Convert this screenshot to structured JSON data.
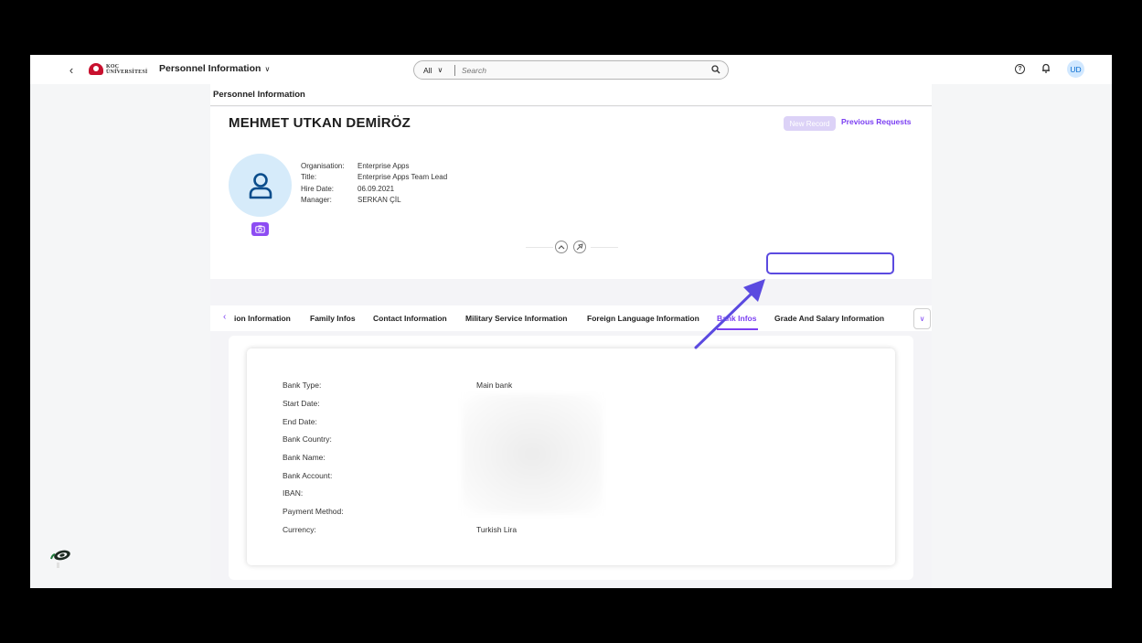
{
  "shell": {
    "logo_line1": "KOÇ",
    "logo_line2": "ÜNİVERSİTESİ",
    "app_title": "Personnel Information",
    "search_scope": "All",
    "search_placeholder": "Search",
    "avatar_initials": "UD"
  },
  "page": {
    "header_title": "Personnel Information",
    "employee_name": "MEHMET UTKAN DEMİRÖZ",
    "new_record_label": "New Record",
    "previous_requests_label": "Previous Requests",
    "attributes": [
      {
        "label": "Organisation:",
        "value": "Enterprise Apps"
      },
      {
        "label": "Title:",
        "value": "Enterprise Apps Team Lead"
      },
      {
        "label": "Hire Date:",
        "value": "06.09.2021"
      },
      {
        "label": "Manager:",
        "value": "SERKAN ÇİL"
      }
    ]
  },
  "tabs": [
    {
      "label": "ion Information",
      "selected": false
    },
    {
      "label": "Family Infos",
      "selected": false
    },
    {
      "label": "Contact Information",
      "selected": false
    },
    {
      "label": "Military Service Information",
      "selected": false
    },
    {
      "label": "Foreign Language Information",
      "selected": false
    },
    {
      "label": "Bank Infos",
      "selected": true
    },
    {
      "label": "Grade And Salary Information",
      "selected": false,
      "highlighted": true
    }
  ],
  "bank_form": {
    "fields": [
      {
        "label": "Bank Type:",
        "value": "Main bank"
      },
      {
        "label": "Start Date:",
        "value": ""
      },
      {
        "label": "End Date:",
        "value": ""
      },
      {
        "label": "Bank Country:",
        "value": ""
      },
      {
        "label": "Bank Name:",
        "value": ""
      },
      {
        "label": "Bank Account:",
        "value": ""
      },
      {
        "label": "IBAN:",
        "value": ""
      },
      {
        "label": "Payment Method:",
        "value": ""
      },
      {
        "label": "Currency:",
        "value": "Turkish Lira"
      }
    ]
  },
  "colors": {
    "accent": "#7b3ff2",
    "highlight": "#5b4ae0",
    "brand_red": "#c8102e"
  },
  "icons": [
    "back-icon",
    "chevron-down-icon",
    "search-icon",
    "help-icon",
    "bell-icon",
    "user-icon",
    "camera-icon",
    "collapse-icon",
    "pin-icon",
    "chevron-left-icon",
    "arrow-annotation-icon",
    "widget-icon"
  ]
}
